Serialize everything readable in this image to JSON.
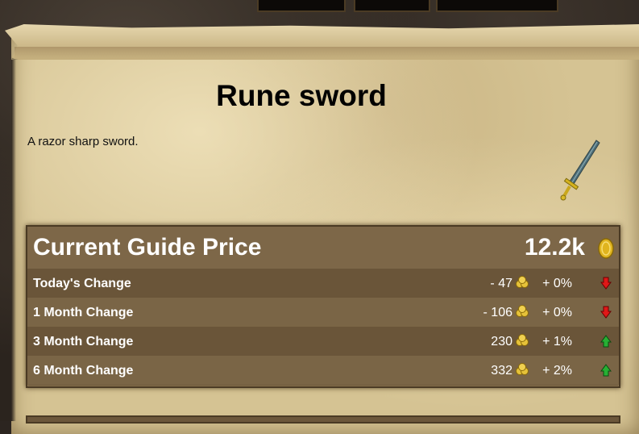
{
  "item": {
    "name": "Rune sword",
    "examine": "A razor sharp sword.",
    "image_icon": "rune-sword-icon"
  },
  "price": {
    "header_label": "Current Guide Price",
    "current_value": "12.2k",
    "currency_icon": "gold-coin-icon"
  },
  "changes": [
    {
      "label": "Today's Change",
      "amount": "- 47",
      "percent": "+ 0%",
      "trend": "down"
    },
    {
      "label": "1 Month Change",
      "amount": "- 106",
      "percent": "+ 0%",
      "trend": "down"
    },
    {
      "label": "3 Month Change",
      "amount": "230",
      "percent": "+ 1%",
      "trend": "up"
    },
    {
      "label": "6 Month Change",
      "amount": "332",
      "percent": "+ 2%",
      "trend": "up"
    }
  ],
  "colors": {
    "trend_down": "#e01818",
    "trend_up": "#27b034",
    "parchment": "#d5c393",
    "panel": "#6c573b"
  }
}
